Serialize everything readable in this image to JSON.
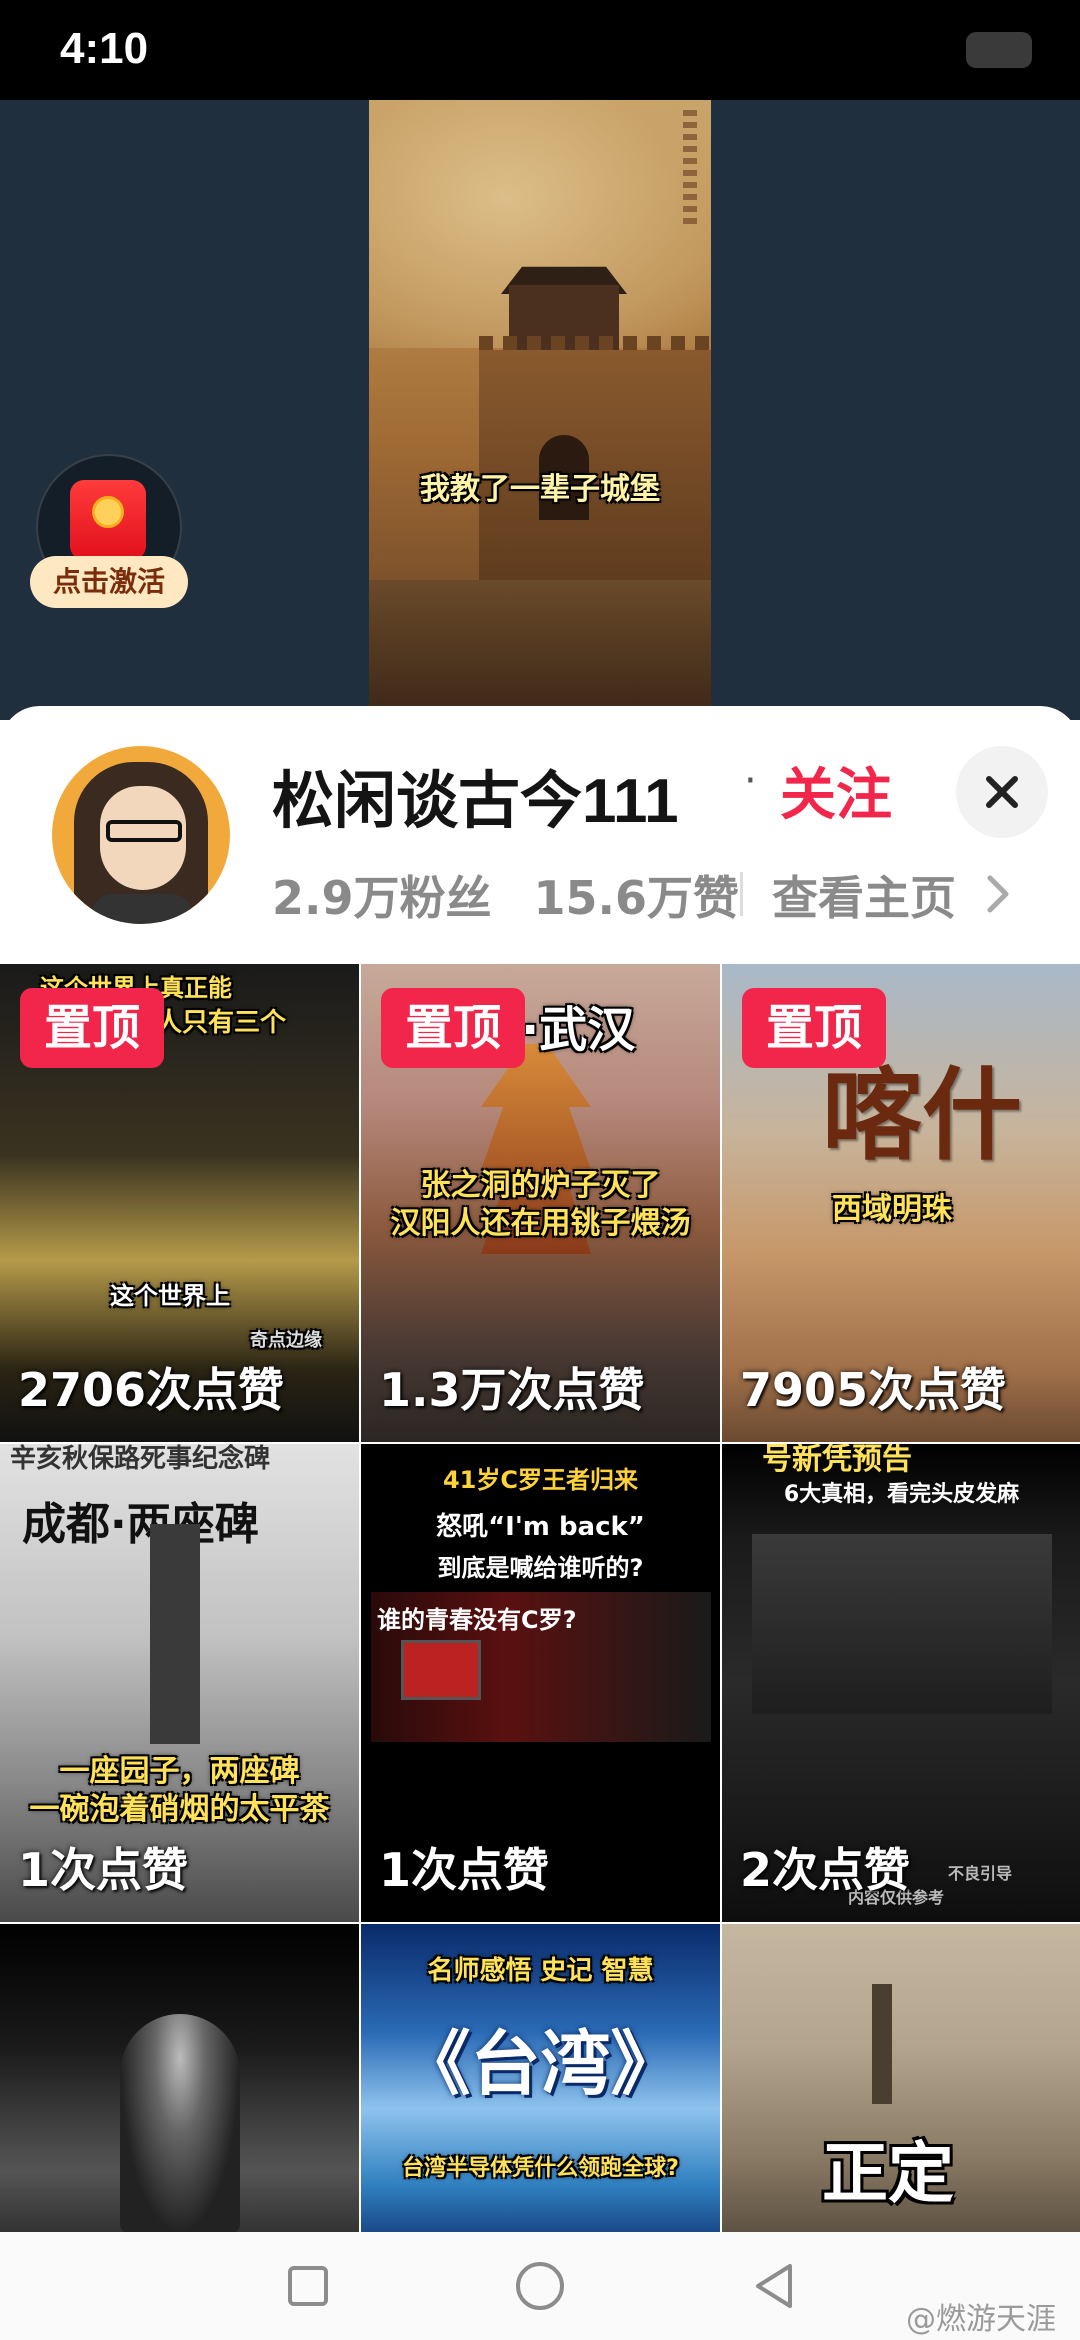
{
  "status_bar": {
    "time": "4:10"
  },
  "video": {
    "caption": "我教了一辈子城堡"
  },
  "red_packet": {
    "label": "点击激活"
  },
  "profile": {
    "username": "松闲谈古今111",
    "separator": "·",
    "follow_label": "关注",
    "followers": "2.9万粉丝",
    "likes": "15.6万赞",
    "view_homepage": "查看主页"
  },
  "grid": {
    "tiles": [
      {
        "pinned": "置顶",
        "likes": "2706次点赞",
        "top_text": "这个世界上真正能",
        "top_text2": "的人只有三个",
        "mid_text": "这个世界上",
        "brand": "奇点边缘"
      },
      {
        "pinned": "置顶",
        "likes": "1.3万次点赞",
        "top_text": "·武汉",
        "line1": "张之洞的炉子灭了",
        "line2": "汉阳人还在用铫子煨汤"
      },
      {
        "pinned": "置顶",
        "likes": "7905次点赞",
        "big_text": "喀什",
        "subtitle": "西域明珠"
      },
      {
        "likes": "1次点赞",
        "top_text": "辛亥秋保路死事纪念碑",
        "title": "成都·两座碑",
        "line1": "一座园子，两座碑",
        "line2": "一碗泡着硝烟的太平茶"
      },
      {
        "likes": "1次点赞",
        "line1": "41岁C罗王者归来",
        "line2": "怒吼“I'm back”",
        "line3": "到底是喊给谁听的?",
        "line4": "谁的青春没有C罗?"
      },
      {
        "likes": "2次点赞",
        "top_text": "号新凭预告",
        "line1": "6大真相，看完头皮发麻",
        "footnote": "不良引导",
        "footnote2": "内容仅供参考"
      },
      {},
      {
        "line1": "名师感悟 史记 智慧",
        "title": "《台湾》",
        "line2": "台湾半导体凭什么领跑全球?"
      },
      {
        "title": "正定"
      }
    ]
  },
  "watermark": "@燃游天涯",
  "colors": {
    "accent": "#f2264b",
    "video_bg": "#1f2f3e"
  }
}
